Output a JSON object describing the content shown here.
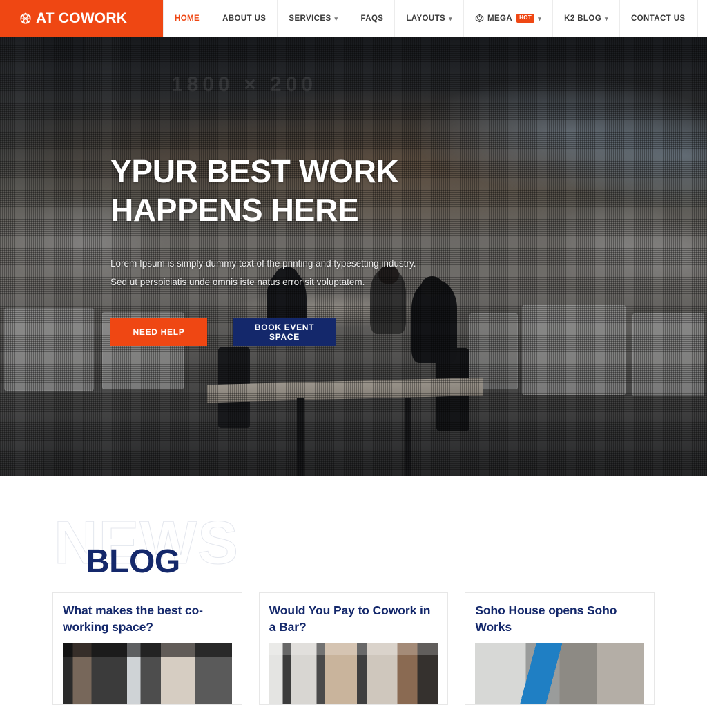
{
  "header": {
    "logo": {
      "icon": "globe-network-icon",
      "text": "AT COWORK"
    },
    "nav": [
      {
        "label": "HOME",
        "active": true,
        "caret": false
      },
      {
        "label": "ABOUT US",
        "active": false,
        "caret": false
      },
      {
        "label": "SERVICES",
        "active": false,
        "caret": true
      },
      {
        "label": "FAQS",
        "active": false,
        "caret": false
      },
      {
        "label": "LAYOUTS",
        "active": false,
        "caret": true
      },
      {
        "label": "MEGA",
        "active": false,
        "caret": true,
        "icon": "cube-icon",
        "badge": "HOT"
      },
      {
        "label": "K2 BLOG",
        "active": false,
        "caret": true
      },
      {
        "label": "CONTACT US",
        "active": false,
        "caret": false
      }
    ],
    "hamburger_icon": "hamburger-menu-icon"
  },
  "hero": {
    "watermark": "1800 × 200",
    "title": "YPUR BEST WORK HAPPENS HERE",
    "desc_line1": "Lorem Ipsum is simply dummy text of the printing and typesetting industry.",
    "desc_line2": "Sed ut perspiciatis unde omnis iste natus error sit voluptatem.",
    "primary_button": "NEED HELP",
    "secondary_button": "BOOK EVENT SPACE"
  },
  "blog": {
    "watermark": "NEWS",
    "title": "BLOG",
    "cards": [
      {
        "title": "What makes the best co-working space?"
      },
      {
        "title": "Would You Pay to Cowork in a Bar?"
      },
      {
        "title": "Soho House opens Soho Works"
      }
    ]
  },
  "colors": {
    "brand_orange": "#ef4713",
    "brand_navy": "#14286b",
    "nav_text": "#3b3b3b",
    "card_border": "#e7e7e7",
    "watermark_outline": "#e4e7ee"
  }
}
